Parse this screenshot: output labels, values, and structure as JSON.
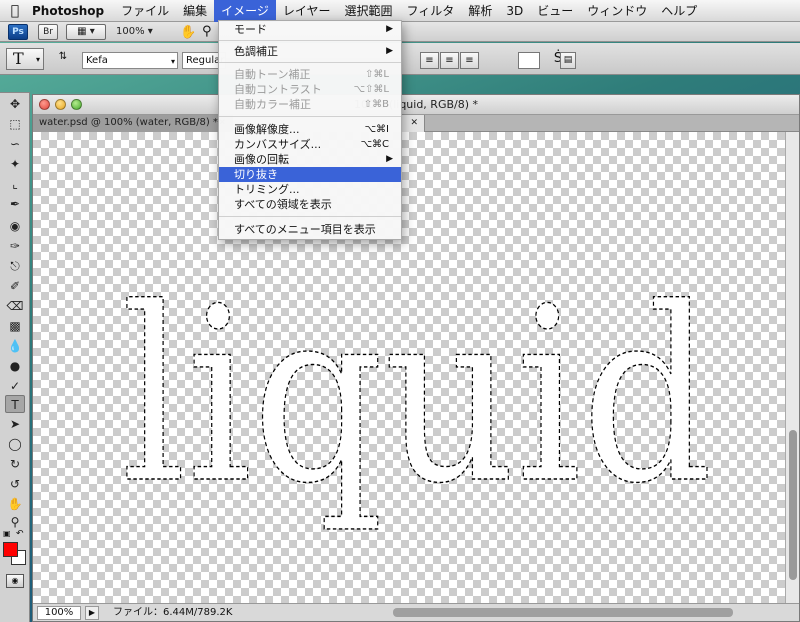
{
  "menubar": {
    "app_name": "Photoshop",
    "items": [
      "ファイル",
      "編集",
      "イメージ",
      "レイヤー",
      "選択範囲",
      "フィルタ",
      "解析",
      "3D",
      "ビュー",
      "ウィンドウ",
      "ヘルプ"
    ],
    "active_item": "イメージ"
  },
  "appbar": {
    "ps_label": "Ps",
    "br_label": "Br",
    "zoom": "100%"
  },
  "options": {
    "tool_glyph": "T",
    "font_family": "Kefa",
    "font_style": "Regular"
  },
  "document": {
    "title": "100% (liquid, RGB/8) *",
    "tabs": [
      {
        "label": "water.psd @ 100% (water, RGB/8) *"
      },
      {
        "label": ""
      }
    ],
    "canvas_text": "liquid",
    "zoom": "100%",
    "file_info": "ファイル：6.44M/789.2K"
  },
  "colors": {
    "foreground": "#ff0000",
    "background": "#ffffff",
    "menu_highlight": "#3a63d8"
  },
  "image_menu": {
    "items": [
      {
        "label": "モード",
        "shortcut": "",
        "submenu": true,
        "disabled": false
      },
      {
        "label": "色調補正",
        "shortcut": "",
        "submenu": true,
        "disabled": false
      },
      {
        "label": "自動トーン補正",
        "shortcut": "⇧⌘L",
        "submenu": false,
        "disabled": true
      },
      {
        "label": "自動コントラスト",
        "shortcut": "⌥⇧⌘L",
        "submenu": false,
        "disabled": true
      },
      {
        "label": "自動カラー補正",
        "shortcut": "⇧⌘B",
        "submenu": false,
        "disabled": true
      },
      {
        "label": "画像解像度...",
        "shortcut": "⌥⌘I",
        "submenu": false,
        "disabled": false
      },
      {
        "label": "カンバスサイズ...",
        "shortcut": "⌥⌘C",
        "submenu": false,
        "disabled": false
      },
      {
        "label": "画像の回転",
        "shortcut": "",
        "submenu": true,
        "disabled": false
      },
      {
        "label": "切り抜き",
        "shortcut": "",
        "submenu": false,
        "disabled": false,
        "highlighted": true
      },
      {
        "label": "トリミング...",
        "shortcut": "",
        "submenu": false,
        "disabled": false
      },
      {
        "label": "すべての領域を表示",
        "shortcut": "",
        "submenu": false,
        "disabled": false
      },
      {
        "label": "すべてのメニュー項目を表示",
        "shortcut": "",
        "submenu": false,
        "disabled": false
      }
    ]
  }
}
